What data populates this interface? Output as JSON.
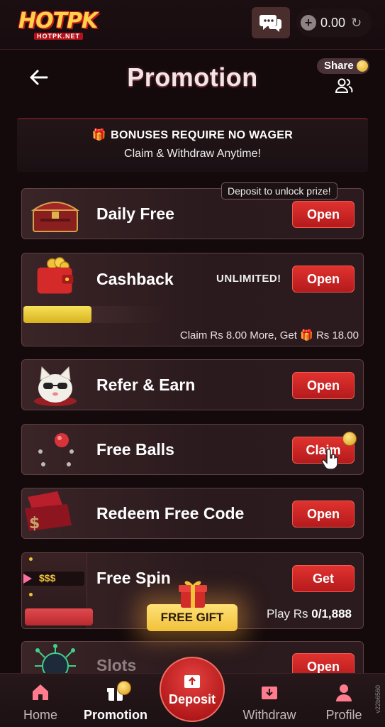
{
  "topbar": {
    "logo_text": "HOTPK",
    "logo_sub": "HOTPK.NET",
    "balance": "0.00"
  },
  "header": {
    "title": "Promotion",
    "share_label": "Share"
  },
  "bonus": {
    "title": "BONUSES REQUIRE NO WAGER",
    "subtitle": "Claim & Withdraw Anytime!"
  },
  "cards": {
    "daily_free": {
      "tag": "Deposit to unlock prize!",
      "title": "Daily Free",
      "button": "Open"
    },
    "cashback": {
      "title": "Cashback",
      "unlimited": "UNLIMITED!",
      "button": "Open",
      "progress_fraction": 0.48,
      "note_prefix": "Claim Rs 8.00 More, Get",
      "note_suffix": "Rs 18.00"
    },
    "refer_earn": {
      "title": "Refer & Earn",
      "button": "Open"
    },
    "free_balls": {
      "title": "Free Balls",
      "button": "Claim"
    },
    "redeem_code": {
      "title": "Redeem Free Code",
      "button": "Open"
    },
    "free_spin": {
      "title": "Free Spin",
      "button": "Get",
      "badge": "$$$",
      "play_label": "Play Rs",
      "play_value": "0/1,888"
    },
    "slots": {
      "title": "Slots",
      "button": "Open"
    }
  },
  "free_gift": "FREE GIFT",
  "nav": {
    "home": "Home",
    "promotion": "Promotion",
    "deposit": "Deposit",
    "withdraw": "Withdraw",
    "profile": "Profile"
  },
  "version": "v22b6560",
  "colors": {
    "background": "#140a0c",
    "card": "#3a2427",
    "button_red": "#d12a28",
    "gold": "#f1c13a"
  }
}
